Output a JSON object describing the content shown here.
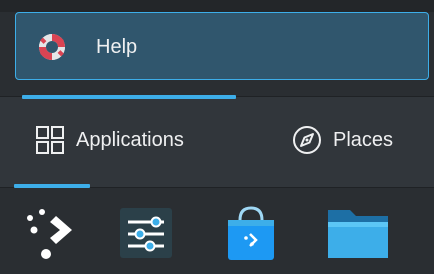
{
  "help": {
    "label": "Help",
    "icon": "lifebuoy-icon"
  },
  "tabs": [
    {
      "label": "Applications",
      "icon": "grid-icon",
      "active": true
    },
    {
      "label": "Places",
      "icon": "compass-icon",
      "active": false
    }
  ],
  "favorites": [
    {
      "icon": "kde-connect-icon"
    },
    {
      "icon": "system-settings-icon"
    },
    {
      "icon": "discover-store-icon"
    },
    {
      "icon": "folder-icon"
    }
  ],
  "colors": {
    "accent": "#3daee9",
    "highlight_bg": "#30566d",
    "panel_bg": "#31363b",
    "text": "#eff0f1"
  }
}
